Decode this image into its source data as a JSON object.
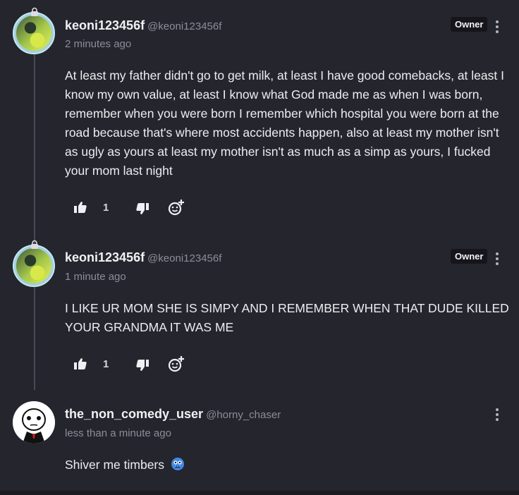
{
  "comments": [
    {
      "username": "keoni123456f",
      "handle": "@keoni123456f",
      "time": "2 minutes ago",
      "badge": "Owner",
      "body": "At least my father didn't go to get milk, at least I have good comebacks, at least I know my own value, at least I know what God made me as when I was born, remember when you were born I remember which hospital you were born at the road because that's where most accidents happen, also at least my mother isn't as ugly as yours at least my mother isn't as much as a simp as yours, I fucked your mom last night",
      "likes": "1"
    },
    {
      "username": "keoni123456f",
      "handle": "@keoni123456f",
      "time": "1 minute ago",
      "badge": "Owner",
      "body": "I LIKE UR MOM SHE IS SIMPY AND I REMEMBER WHEN THAT DUDE KILLED YOUR GRANDMA IT WAS ME",
      "likes": "1"
    },
    {
      "username": "the_non_comedy_user",
      "handle": "@horny_chaser",
      "time": "less than a minute ago",
      "body": "Shiver me timbers"
    }
  ],
  "icons": {
    "like": "thumbs-up-icon",
    "dislike": "thumbs-down-icon",
    "react": "add-reaction-icon",
    "more": "vertical-ellipsis-icon",
    "emoji": "blue-monster-emoji"
  },
  "colors": {
    "background": "#25252d",
    "badge_bg": "#15151b",
    "muted": "#8d8d99"
  }
}
